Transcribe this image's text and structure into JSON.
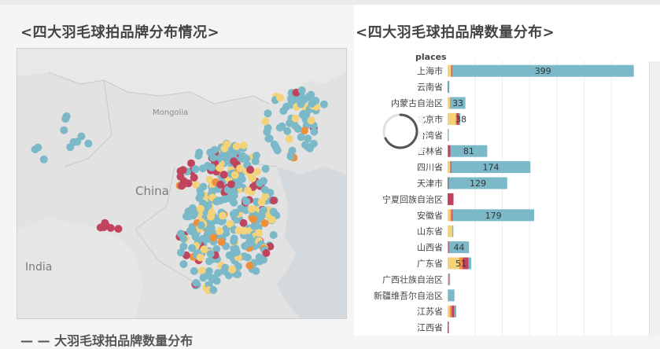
{
  "titles": {
    "map": "<四大羽毛球拍品牌分布情况>",
    "bar": "<四大羽毛球拍品牌数量分布>",
    "bottom": "— — 大羽毛球拍品牌数量分布"
  },
  "map": {
    "labels": {
      "mongolia": "Mongolia",
      "china": "China",
      "india": "India"
    },
    "colors": {
      "teal": "#7bb9c9",
      "yellow": "#f4d27a",
      "red": "#c0445e",
      "orange": "#ee8f3a",
      "land": "#e3e3e3",
      "water": "#cfd6da"
    }
  },
  "chart_data": {
    "type": "bar",
    "orientation": "horizontal-stacked",
    "category_header": "places",
    "categories": [
      "上海市",
      "云南省",
      "内蒙古自治区",
      "北京市",
      "台湾省",
      "吉林省",
      "四川省",
      "天津市",
      "宁夏回族自治区",
      "安徽省",
      "山东省",
      "山西省",
      "广东省",
      "广西壮族自治区",
      "新疆维吾尔自治区",
      "江苏省",
      "江西省"
    ],
    "colors": [
      "#f4d27a",
      "#ee8f3a",
      "#c0445e",
      "#7bb9c9"
    ],
    "stacks": [
      [
        7,
        2,
        1,
        399
      ],
      [
        0,
        0,
        1,
        3
      ],
      [
        5,
        1,
        0,
        33
      ],
      [
        18,
        2,
        5,
        3
      ],
      [
        0,
        0,
        0,
        1
      ],
      [
        0,
        1,
        5,
        81
      ],
      [
        6,
        0,
        2,
        174
      ],
      [
        0,
        0,
        2,
        129
      ],
      [
        0,
        0,
        13,
        0
      ],
      [
        6,
        3,
        2,
        179
      ],
      [
        10,
        0,
        0,
        2
      ],
      [
        1,
        0,
        2,
        44
      ],
      [
        26,
        7,
        13,
        6
      ],
      [
        2,
        0,
        1,
        2
      ],
      [
        1,
        0,
        0,
        14
      ],
      [
        5,
        4,
        6,
        4
      ],
      [
        0,
        0,
        1,
        0
      ]
    ],
    "labels": [
      "399",
      "",
      "33",
      "38",
      "",
      "81",
      "174",
      "129",
      "",
      "179",
      "",
      "44",
      "51",
      "",
      "",
      "",
      ""
    ],
    "xlim": [
      0,
      420
    ]
  }
}
